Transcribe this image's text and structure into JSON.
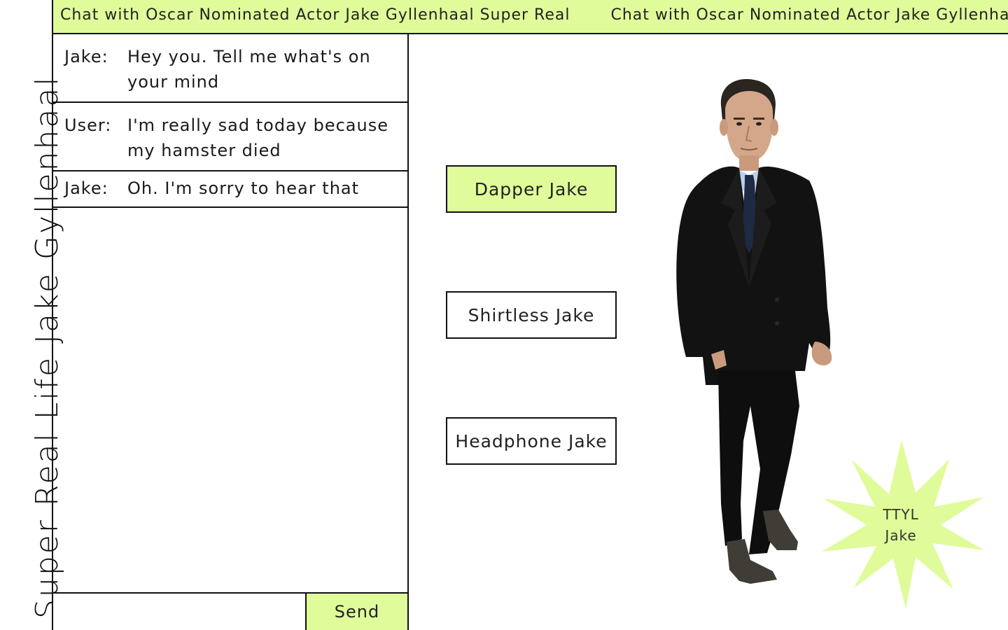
{
  "app": {
    "vertical_title": "Super Real Life Jake Gyllenhaal",
    "banner_text": "Chat with Oscar Nominated Actor Jake Gyllenhaal Super Real",
    "accent_color": "#e0fc9a"
  },
  "chat": {
    "messages": [
      {
        "speaker": "Jake:",
        "text": "Hey you. Tell me what's on your mind"
      },
      {
        "speaker": "User:",
        "text": "I'm really sad today because my hamster died"
      },
      {
        "speaker": "Jake:",
        "text": "Oh. I'm sorry to hear that"
      }
    ],
    "input_value": "",
    "input_placeholder": "",
    "send_label": "Send"
  },
  "jake_options": [
    {
      "label": "Dapper Jake",
      "selected": true
    },
    {
      "label": "Shirtless Jake",
      "selected": false
    },
    {
      "label": "Headphone Jake",
      "selected": false
    }
  ],
  "ttyl": {
    "line1": "TTYL",
    "line2": "Jake"
  }
}
